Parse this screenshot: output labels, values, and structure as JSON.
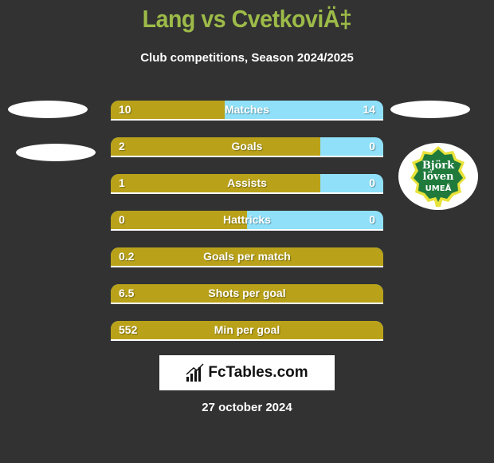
{
  "header": {
    "title": "Lang vs CvetkoviÄ‡",
    "subtitle": "Club competitions, Season 2024/2025"
  },
  "colors": {
    "left_player": "#b9a219",
    "right_player": "#8fe0f8",
    "title": "#9dbb48",
    "background": "#323232"
  },
  "stats": [
    {
      "label": "Matches",
      "left": "10",
      "right": "14",
      "left_share": 0.417
    },
    {
      "label": "Goals",
      "left": "2",
      "right": "0",
      "left_share": 0.77
    },
    {
      "label": "Assists",
      "left": "1",
      "right": "0",
      "left_share": 0.77
    },
    {
      "label": "Hattricks",
      "left": "0",
      "right": "0",
      "left_share": 0.5
    },
    {
      "label": "Goals per match",
      "left": "0.2",
      "right": "",
      "left_share": 1.0
    },
    {
      "label": "Shots per goal",
      "left": "6.5",
      "right": "",
      "left_share": 1.0
    },
    {
      "label": "Min per goal",
      "left": "552",
      "right": "",
      "left_share": 1.0
    }
  ],
  "right_team": {
    "logo": "Björklöven Umeå",
    "logo_lines": [
      "Björk",
      "löven",
      "UMEÅ"
    ]
  },
  "footer": {
    "brand": "FcTables.com",
    "date": "27 october 2024"
  }
}
